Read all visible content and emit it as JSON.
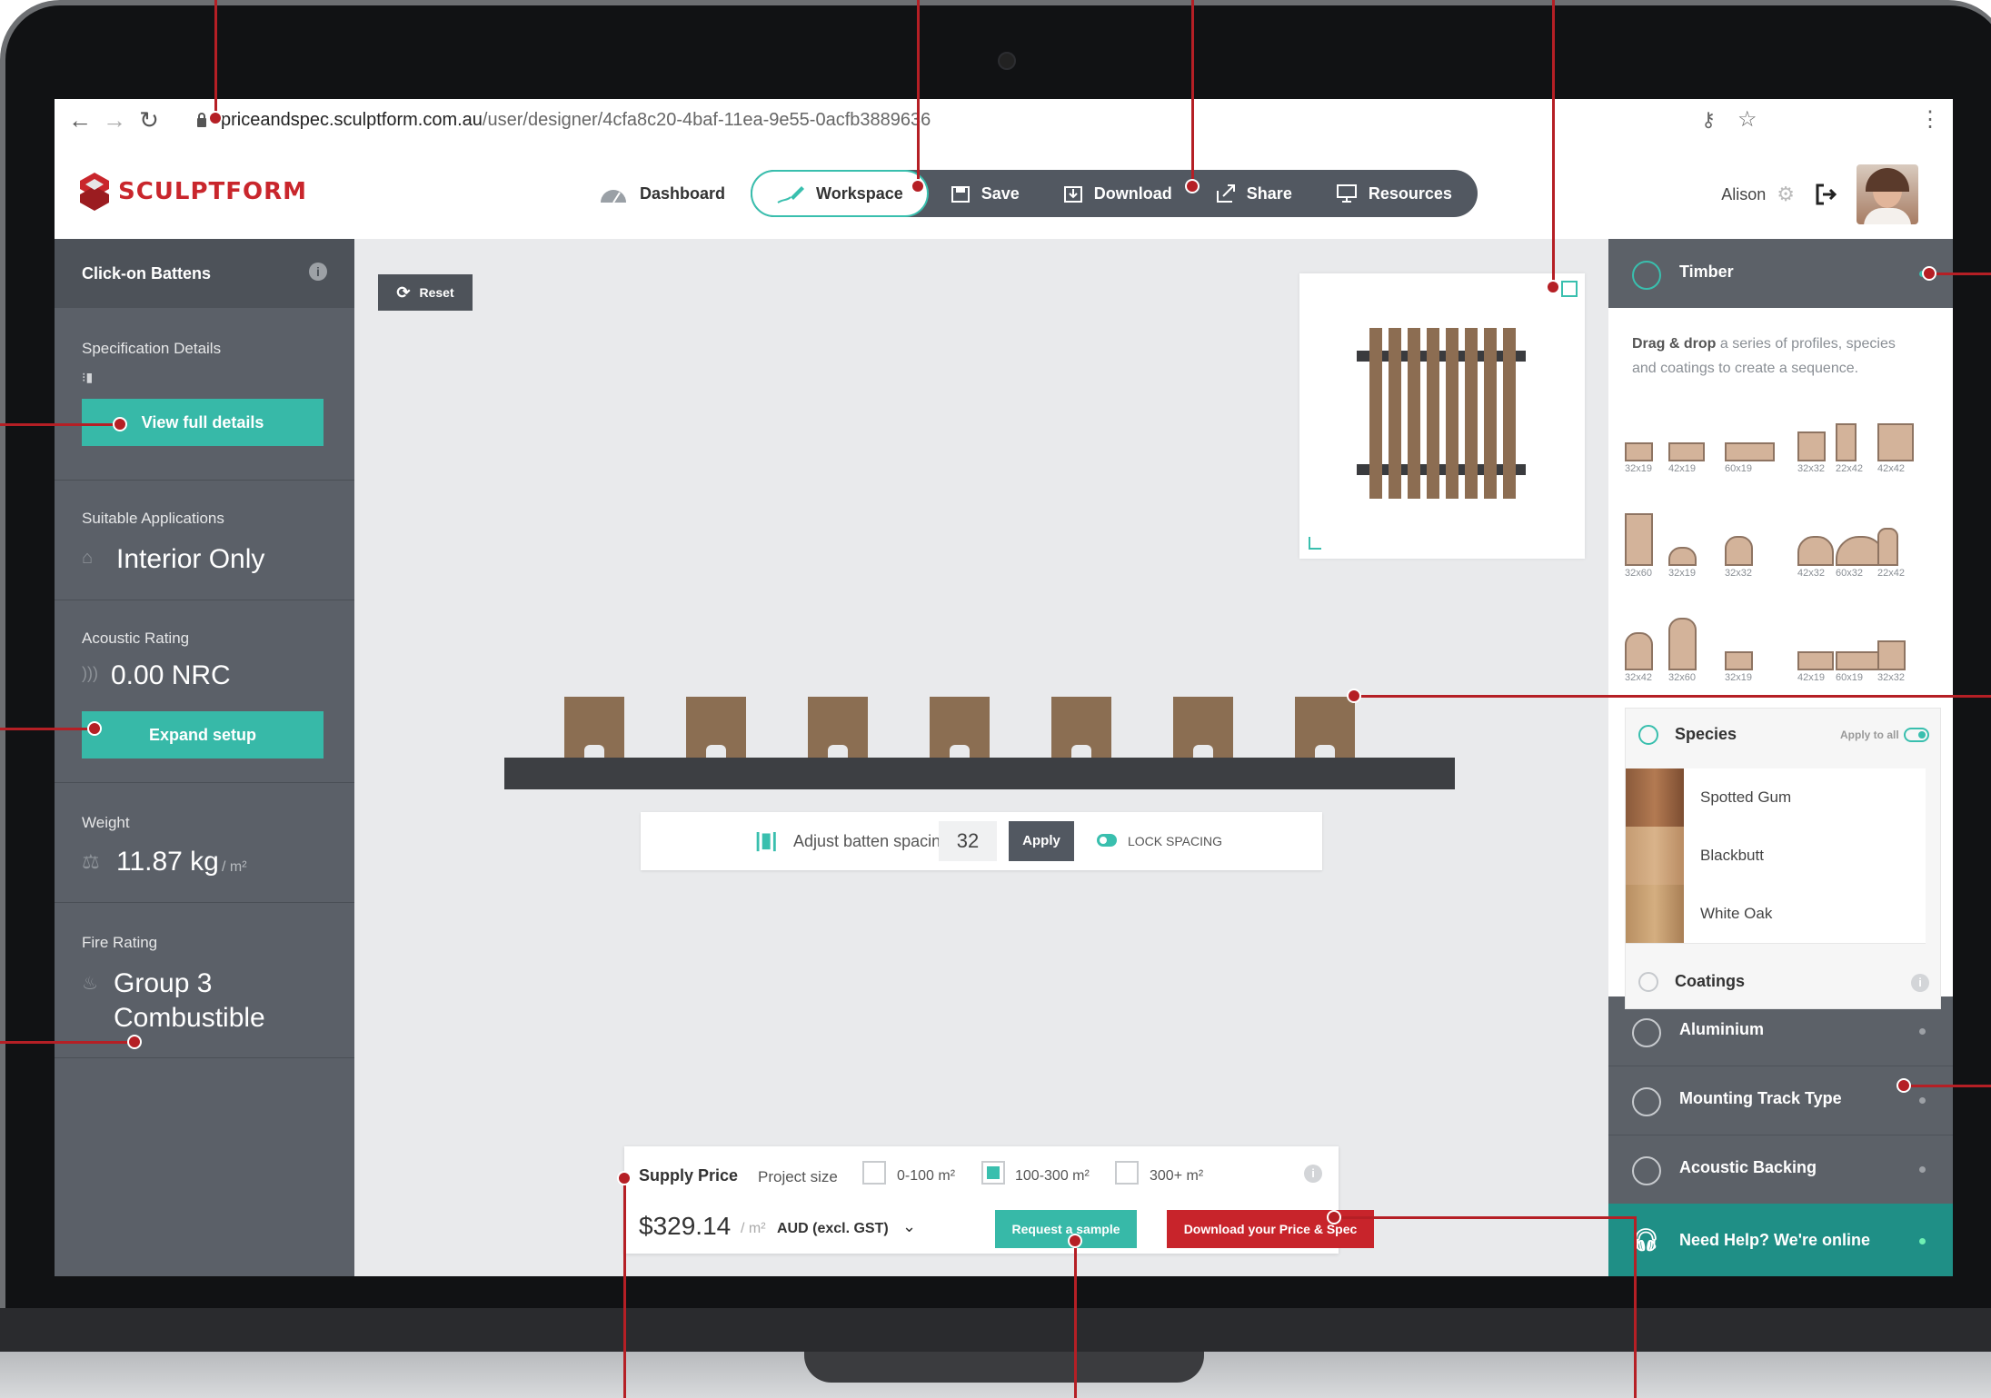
{
  "browser": {
    "url_host": "priceandspec.sculptform.com.au",
    "url_path": "/user/designer/4cfa8c20-4baf-11ea-9e55-0acfb3889636"
  },
  "brand": {
    "logo_text": "SCULPTFORM",
    "accent": "#c9262c",
    "teal": "#37b9a8"
  },
  "topnav": {
    "dashboard": "Dashboard",
    "workspace": "Workspace",
    "save": "Save",
    "download": "Download",
    "share": "Share",
    "resources": "Resources"
  },
  "user": {
    "name": "Alison"
  },
  "left_panel": {
    "title": "Click-on Battens",
    "spec_label": "Specification Details",
    "view_details_button": "View full details",
    "applications_label": "Suitable Applications",
    "applications_value": "Interior Only",
    "acoustic_label": "Acoustic Rating",
    "acoustic_value": "0.00 NRC",
    "expand_button": "Expand setup",
    "weight_label": "Weight",
    "weight_value": "11.87 kg",
    "weight_unit": "/ m²",
    "fire_label": "Fire Rating",
    "fire_value_line1": "Group 3",
    "fire_value_line2": "Combustible"
  },
  "workspace": {
    "reset_button": "Reset",
    "spacing_label": "Adjust batten spacing",
    "spacing_value": "32",
    "apply_button": "Apply",
    "lock_label": "LOCK SPACING",
    "lock_on": true,
    "batten_count": 7
  },
  "supply": {
    "title": "Supply Price",
    "project_size_label": "Project size",
    "options": [
      "0-100 m²",
      "100-300 m²",
      "300+ m²"
    ],
    "selected_option": "100-300 m²",
    "price": "$329.14",
    "price_unit": "/ m²",
    "currency": "AUD (excl. GST)",
    "sample_button": "Request a sample",
    "download_button": "Download your Price & Spec"
  },
  "right_panel": {
    "timber_label": "Timber",
    "timber_help_bold": "Drag & drop",
    "timber_help_rest": "a series of profiles, species and coatings to create a sequence.",
    "profiles_row1": [
      "32x19",
      "42x19",
      "60x19",
      "32x32",
      "22x42",
      "42x42"
    ],
    "profiles_row2": [
      "32x60",
      "32x19",
      "32x32",
      "42x32",
      "60x32",
      "22x42"
    ],
    "profiles_row3": [
      "32x42",
      "32x60",
      "32x19",
      "42x19",
      "60x19",
      "32x32"
    ],
    "species_label": "Species",
    "apply_to_all": "Apply to all",
    "species": [
      "Spotted Gum",
      "Blackbutt",
      "White Oak"
    ],
    "coatings_label": "Coatings",
    "aluminium_label": "Aluminium",
    "mounting_label": "Mounting Track Type",
    "acoustic_label": "Acoustic Backing",
    "help_label": "Need Help? We're online"
  }
}
